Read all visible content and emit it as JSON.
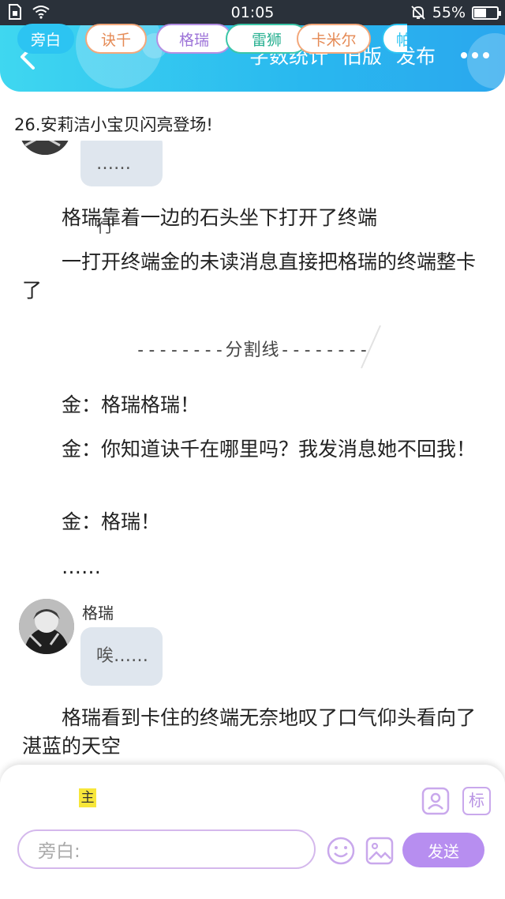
{
  "status_bar": {
    "time": "01:05",
    "battery": "55%",
    "battery_level": 0.55,
    "icons": [
      "sim-icon",
      "wifi-icon",
      "mute-bell-icon",
      "battery-icon"
    ]
  },
  "header": {
    "back_icon": "chevron-left-icon",
    "actions": {
      "word_count": "字数统计",
      "old_version": "旧版",
      "publish": "发布"
    },
    "more_icon": "more-dots-icon",
    "colors": {
      "start": "#3fd7f0",
      "end": "#2aa7ee"
    }
  },
  "chapter": {
    "title": "26.安莉洁小宝贝闪亮登场!"
  },
  "content": {
    "partial_bubble": "……行",
    "para_1": "格瑞靠着一边的石头坐下打开了终端",
    "para_2": "一打开终端金的未读消息直接把格瑞的终端整卡了",
    "divider": "--------分割线--------",
    "para_3": "金：格瑞格瑞！",
    "para_4": "金：你知道诀千在哪里吗？我发消息她不回我！",
    "para_5": "金：格瑞！",
    "para_6": "……",
    "chat": {
      "name": "格瑞",
      "message": "唉……"
    },
    "para_7": "格瑞看到卡住的终端无奈地叹了口气仰头看向了湛蓝的天空"
  },
  "editor": {
    "host_badge": "主",
    "characters": [
      {
        "label": "旁白",
        "color": "#2cc4f2",
        "active": true
      },
      {
        "label": "诀千",
        "color": "#f3a77a",
        "active": false
      },
      {
        "label": "格瑞",
        "color": "#b38ee3",
        "active": false
      },
      {
        "label": "雷狮",
        "color": "#3cc6a8",
        "active": false
      },
      {
        "label": "卡米尔",
        "color": "#f3a77a",
        "active": false
      },
      {
        "label": "帕",
        "color": "#2cc4f2",
        "active": false
      }
    ],
    "tool_icons": [
      "person-card-icon",
      "tag-icon"
    ],
    "tag_label": "标",
    "input_placeholder": "旁白:",
    "emoji_icon": "emoji-icon",
    "image_icon": "image-icon",
    "send": "发送",
    "send_color": "#b78ef0"
  }
}
